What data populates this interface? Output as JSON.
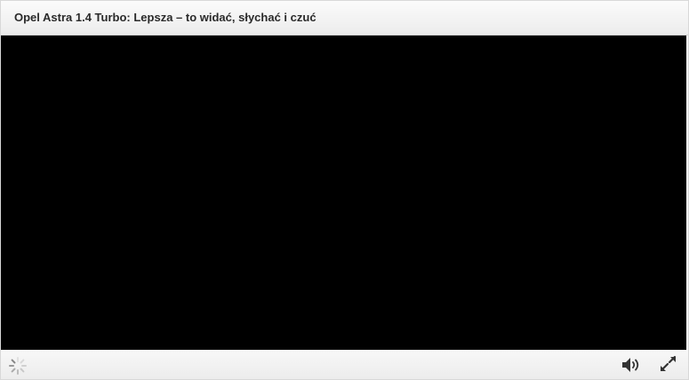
{
  "player": {
    "title": "Opel Astra 1.4 Turbo: Lepsza – to widać, słychać i czuć"
  },
  "controls": {
    "loading_icon": "loading-spinner-icon",
    "volume_icon": "speaker-volume-icon",
    "fullscreen_icon": "fullscreen-expand-icon"
  },
  "colors": {
    "video_background": "#000000",
    "title_text": "#2a2a2a",
    "icon": "#333333"
  }
}
